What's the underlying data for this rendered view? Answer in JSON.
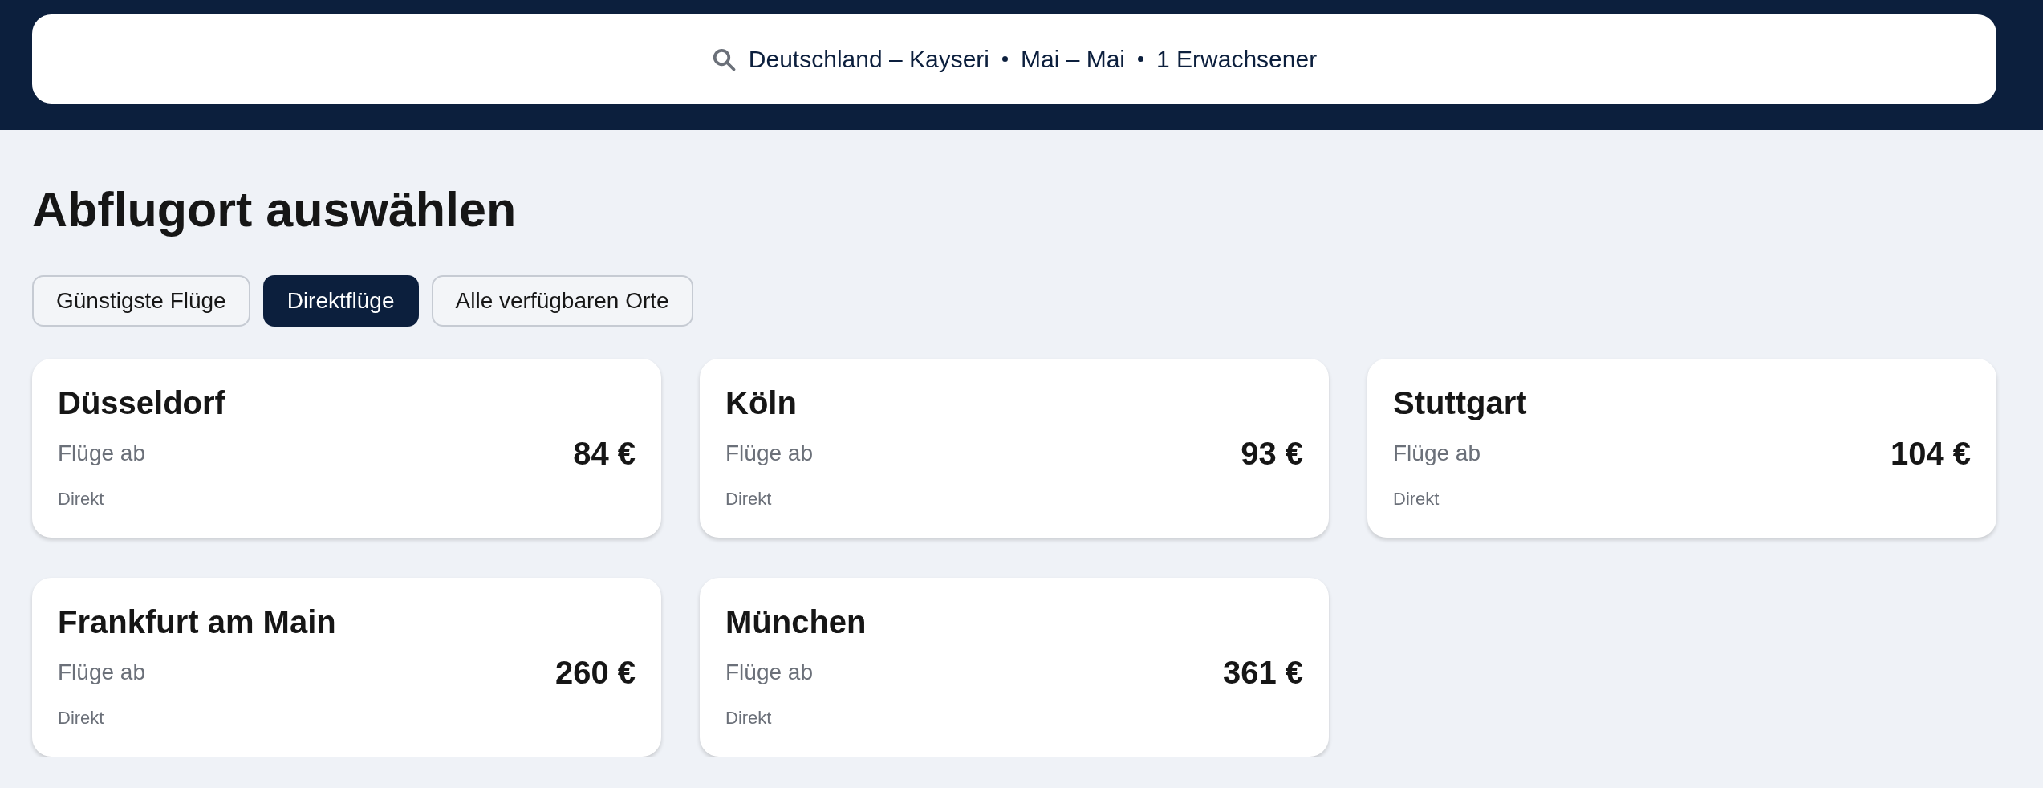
{
  "search": {
    "parts": [
      "Deutschland – Kayseri",
      "Mai – Mai",
      "1 Erwachsener"
    ]
  },
  "heading": "Abflugort auswählen",
  "filters": [
    {
      "label": "Günstigste Flüge",
      "selected": false
    },
    {
      "label": "Direktflüge",
      "selected": true
    },
    {
      "label": "Alle verfügbaren Orte",
      "selected": false
    }
  ],
  "cards": [
    {
      "city": "Düsseldorf",
      "label": "Flüge ab",
      "price": "84 €",
      "note": "Direkt"
    },
    {
      "city": "Köln",
      "label": "Flüge ab",
      "price": "93 €",
      "note": "Direkt"
    },
    {
      "city": "Stuttgart",
      "label": "Flüge ab",
      "price": "104 €",
      "note": "Direkt"
    },
    {
      "city": "Frankfurt am Main",
      "label": "Flüge ab",
      "price": "260 €",
      "note": "Direkt"
    },
    {
      "city": "München",
      "label": "Flüge ab",
      "price": "361 €",
      "note": "Direkt"
    }
  ]
}
